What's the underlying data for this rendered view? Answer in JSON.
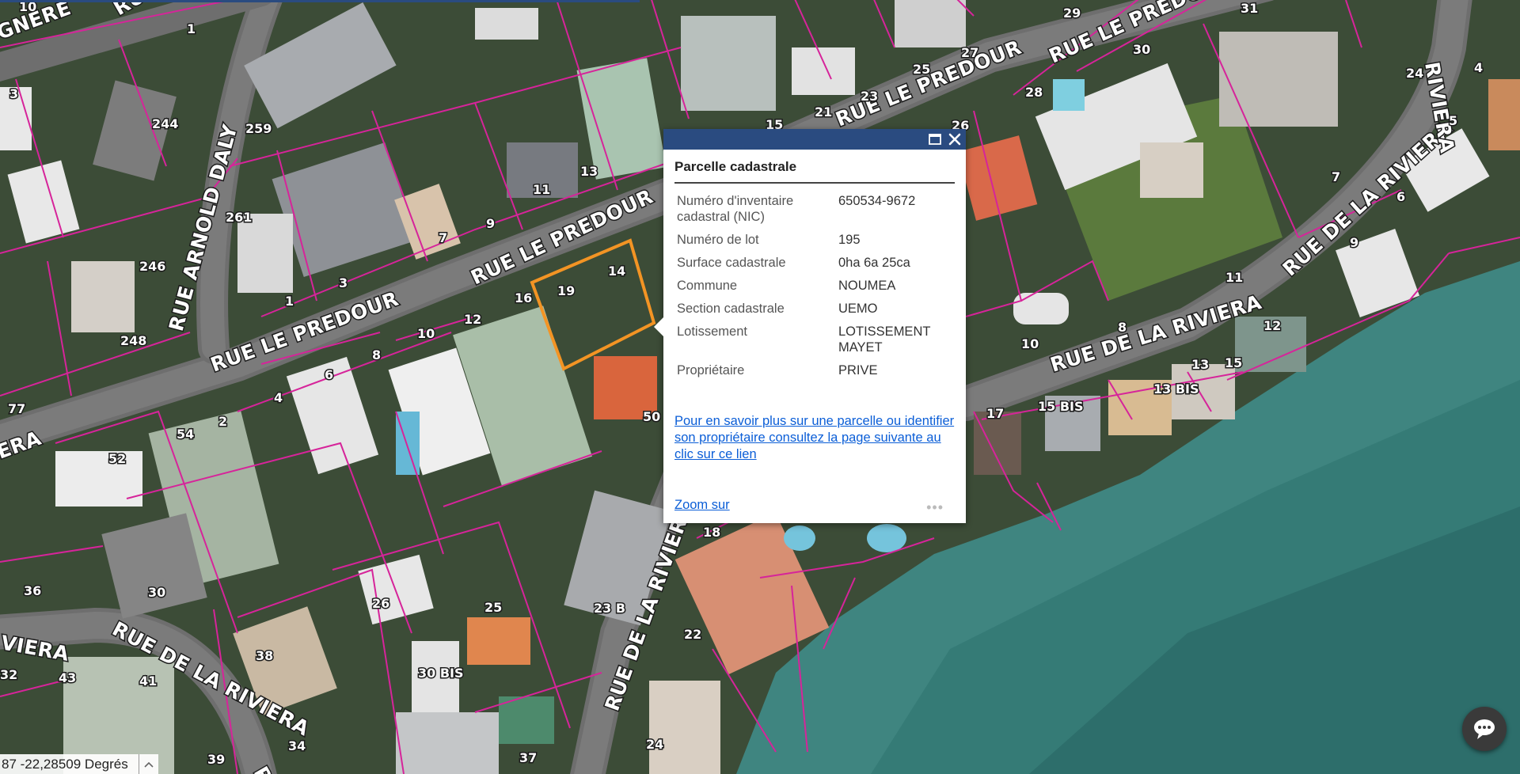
{
  "popup": {
    "title": "Parcelle cadastrale",
    "maximize_icon": "maximize-icon",
    "close_icon": "close-icon",
    "fields": [
      {
        "label": "Numéro d'inventaire cadastral (NIC)",
        "value": "650534-9672"
      },
      {
        "label": "Numéro de lot",
        "value": "195"
      },
      {
        "label": "Surface cadastrale",
        "value": "0ha 6a 25ca"
      },
      {
        "label": "Commune",
        "value": "NOUMEA"
      },
      {
        "label": "Section cadastrale",
        "value": "UEMO"
      },
      {
        "label": "Lotissement",
        "value": "LOTISSEMENT MAYET"
      },
      {
        "label": "Propriétaire",
        "value": "PRIVE"
      }
    ],
    "info_link": "Pour en savoir plus sur une parcelle ou identifier son propriétaire consultez la page suivante au clic sur ce lien",
    "zoom_link": "Zoom sur",
    "more_label": "•••"
  },
  "coordinates": {
    "text": "87 -22,28509 Degrés",
    "toggle_icon": "chevron-up-icon"
  },
  "chat_button": {
    "icon": "chat-icon"
  },
  "map": {
    "colors": {
      "parcel_line": "#d6249a",
      "selected_parcel": "#f39424",
      "road": "#6e6e6e",
      "vegetation": "#2f4a2b",
      "sea": "#3f8580"
    },
    "street_labels": [
      "GNERE",
      "RUE A",
      "RUE ARNOLD DALY",
      "RUE LE PREDOUR",
      "RUE LE PREDOUR",
      "RUE LE PREDOUR",
      "RUE LE PREDOUR",
      "RUE DE LA RIVIERA",
      "RUE DE LA RIVIERA",
      "RUE DE LA RIVIERA",
      "RUE DE LA RIVIERA",
      "RIVIERA",
      "ERA",
      "VIERA",
      "RU"
    ],
    "parcel_numbers": [
      "10",
      "1",
      "3",
      "244",
      "259",
      "261",
      "246",
      "248",
      "77",
      "1",
      "3",
      "7",
      "9",
      "11",
      "13",
      "15",
      "21",
      "23",
      "25",
      "27",
      "29",
      "31",
      "30",
      "28",
      "26",
      "24",
      "4",
      "5",
      "7",
      "6",
      "9",
      "11",
      "8",
      "10",
      "12",
      "13",
      "15",
      "13 BIS",
      "15 BIS",
      "17",
      "19",
      "14",
      "16",
      "12",
      "10",
      "8",
      "6",
      "4",
      "2",
      "54",
      "52",
      "50",
      "18",
      "23 B",
      "22",
      "25",
      "26",
      "30 BIS",
      "30",
      "36",
      "38",
      "34",
      "32",
      "43",
      "41",
      "39",
      "37",
      "24",
      "27"
    ]
  }
}
